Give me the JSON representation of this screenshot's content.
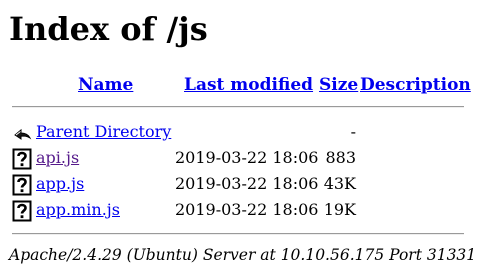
{
  "page": {
    "title": "Index of /js"
  },
  "table": {
    "headers": {
      "name": "Name",
      "last_modified": "Last modified",
      "size": "Size",
      "description": "Description"
    },
    "rows": [
      {
        "icon": "back-arrow-icon",
        "name": "Parent Directory",
        "last_modified": "",
        "size": "-",
        "description": ""
      },
      {
        "icon": "unknown-file-icon",
        "name": "api.js",
        "last_modified": "2019-03-22 18:06",
        "size": "883",
        "description": ""
      },
      {
        "icon": "unknown-file-icon",
        "name": "app.js",
        "last_modified": "2019-03-22 18:06",
        "size": "43K",
        "description": ""
      },
      {
        "icon": "unknown-file-icon",
        "name": "app.min.js",
        "last_modified": "2019-03-22 18:06",
        "size": "19K",
        "description": ""
      }
    ]
  },
  "footer": {
    "address": "Apache/2.4.29 (Ubuntu) Server at 10.10.56.175 Port 31331"
  },
  "colors": {
    "link": "#0000ee",
    "visited_link": "#551a8b",
    "text": "#000000",
    "background": "#ffffff"
  }
}
